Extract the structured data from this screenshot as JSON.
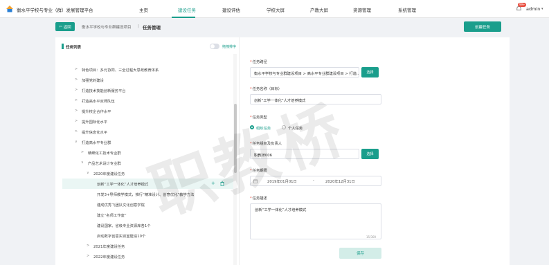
{
  "brand": {
    "title": "衡水平学校与专业（群）发展管理平台"
  },
  "nav": {
    "items": [
      "主页",
      "建设任务",
      "建设评估",
      "学校大屏",
      "产教大屏",
      "资源管理",
      "系统管理"
    ],
    "active": "建设任务"
  },
  "user": {
    "name": "admin",
    "badge": "99+"
  },
  "header": {
    "back_label": "返回",
    "breadcrumb_parent": "衡水平学校与专业群建设项目",
    "breadcrumb_sep": "|",
    "breadcrumb_current": "任务管理",
    "create_label": "创建任务"
  },
  "panel": {
    "title": "任务列表",
    "toggle_label": "拖拽排序"
  },
  "tree": [
    {
      "caret": ">",
      "text": "特色项目：多元协同、三全过程大思政教育体系"
    },
    {
      "caret": ">",
      "text": "加强党的建设"
    },
    {
      "caret": ">",
      "text": "打造技术技能创新服务平台"
    },
    {
      "caret": ">",
      "text": "打造高水平双师队伍"
    },
    {
      "caret": ">",
      "text": "提升校企合作水平"
    },
    {
      "caret": ">",
      "text": "提升国际化水平"
    },
    {
      "caret": ">",
      "text": "提升信息化水平"
    },
    {
      "caret": "∨",
      "text": "打造高水平专业群"
    },
    {
      "caret": ">",
      "text": "精细化工技术专业群"
    },
    {
      "caret": "∨",
      "text": "产品艺术设计专业群"
    },
    {
      "caret": "∨",
      "text": "2020年度建设任务"
    },
    {
      "caret": "",
      "text": "创新“工学一体化”人才培养模式",
      "selected": true
    },
    {
      "caret": "",
      "text": "开发3+导师教学模式，推行“精准设计、创意优化”教学方法"
    },
    {
      "caret": "",
      "text": "建成优秀飞团队文化创意学院"
    },
    {
      "caret": "",
      "text": "建立“名师工作室”"
    },
    {
      "caret": "",
      "text": "建设国家、省级专业资源库各1个"
    },
    {
      "caret": "",
      "text": "启动数字创意实训室建设10个"
    },
    {
      "caret": ">",
      "text": "2021年度建设任务"
    },
    {
      "caret": ">",
      "text": "2022年度建设任务"
    }
  ],
  "row_actions": {
    "add": "+"
  },
  "form": {
    "path_label": "任务路径",
    "path_value": "衡水平学校与专业群建设项目 > 高水平专业群建设项目 > 打造...",
    "select_label": "选择",
    "name_label": "任务名称（目标）",
    "name_value": "创新“工学一体化”人才培养模式",
    "type_label": "任务类型",
    "type_options": [
      "组织任务",
      "个人任务"
    ],
    "type_selected": "组织任务",
    "owner_label": "任务组织及负责人",
    "owner_value": "职教桥006",
    "period_label": "任务期限",
    "start_date": "2019年01月01日",
    "date_sep": "-",
    "end_date": "2020年12月31日",
    "desc_label": "任务描述",
    "desc_value": "创新“工学一体化”人才培养模式",
    "counter": "15/300",
    "save_label": "保存",
    "required_mark": "*"
  },
  "watermark": "职教桥",
  "colors": {
    "accent": "#1a9e8c",
    "badge": "#e84c3d"
  }
}
